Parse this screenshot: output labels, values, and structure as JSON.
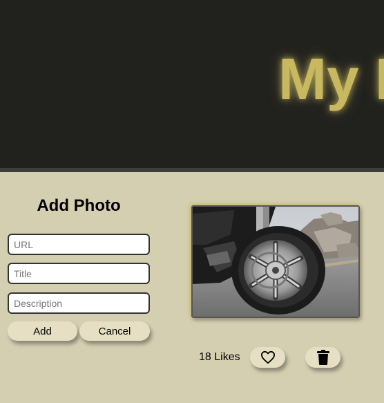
{
  "header": {
    "title": "My Photos"
  },
  "form": {
    "title": "Add Photo",
    "url_placeholder": "URL",
    "title_placeholder": "Title",
    "description_placeholder": "Description",
    "add_label": "Add",
    "cancel_label": "Cancel"
  },
  "photo_card": {
    "image_alt": "Motorcycle front wheel",
    "likes_text": "18 Likes",
    "like_icon": "heart-icon",
    "delete_icon": "trash-icon"
  },
  "colors": {
    "background": "#d5cfb2",
    "header_background": "#21211e",
    "title_glow": "#c8b960",
    "button_background": "#e6dfc3"
  }
}
